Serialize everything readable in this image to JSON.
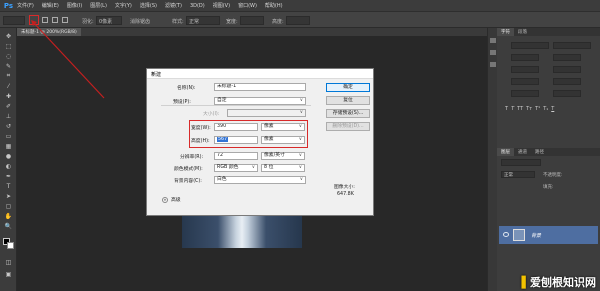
{
  "app": {
    "logo": "Ps"
  },
  "menu": [
    "文件(F)",
    "编辑(E)",
    "图像(I)",
    "图层(L)",
    "文字(Y)",
    "选择(S)",
    "滤镜(T)",
    "3D(D)",
    "视图(V)",
    "窗口(W)",
    "帮助(H)"
  ],
  "options": {
    "feather_label": "羽化:",
    "feather_value": "0像素",
    "antialias": "消除锯齿",
    "style_label": "样式:",
    "style_value": "正常",
    "width_label": "宽度:",
    "height_label": "高度:"
  },
  "document_tab": {
    "label": "未标题-1 @ 200%(RGB/8)"
  },
  "right_panel": {
    "tabs": [
      "字符",
      "段落"
    ],
    "layers_tabs": [
      "图层",
      "通道",
      "路径"
    ],
    "blend_mode": "正常",
    "opacity_label": "不透明度:",
    "fill_label": "填充:",
    "layer_name": "背景"
  },
  "dialog": {
    "title": "新建",
    "name_label": "名称(N):",
    "name_value": "未标题-1",
    "preset_label": "预设(P):",
    "preset_value": "自定",
    "size_label": "大小(I):",
    "width_label": "宽度(W):",
    "width_value": "390",
    "width_unit": "像素",
    "height_label": "高度(H):",
    "height_value": "567",
    "height_unit": "像素",
    "resolution_label": "分辨率(R):",
    "resolution_value": "72",
    "resolution_unit": "像素/英寸",
    "color_mode_label": "颜色模式(M):",
    "color_mode_value": "RGB 颜色",
    "color_depth": "8 位",
    "background_label": "背景内容(C):",
    "background_value": "白色",
    "advanced_label": "高级",
    "image_size_label": "图像大小:",
    "image_size_value": "647.8K",
    "buttons": {
      "ok": "确定",
      "reset": "复位",
      "save_preset": "存储预设(S)...",
      "delete_preset": "删除预设(D)..."
    }
  },
  "watermark": {
    "text": "爱刨根知识网"
  },
  "colors": {
    "highlight": "#d82a2a",
    "selection": "#3375d6",
    "layer_selected": "#4e6ea1"
  }
}
